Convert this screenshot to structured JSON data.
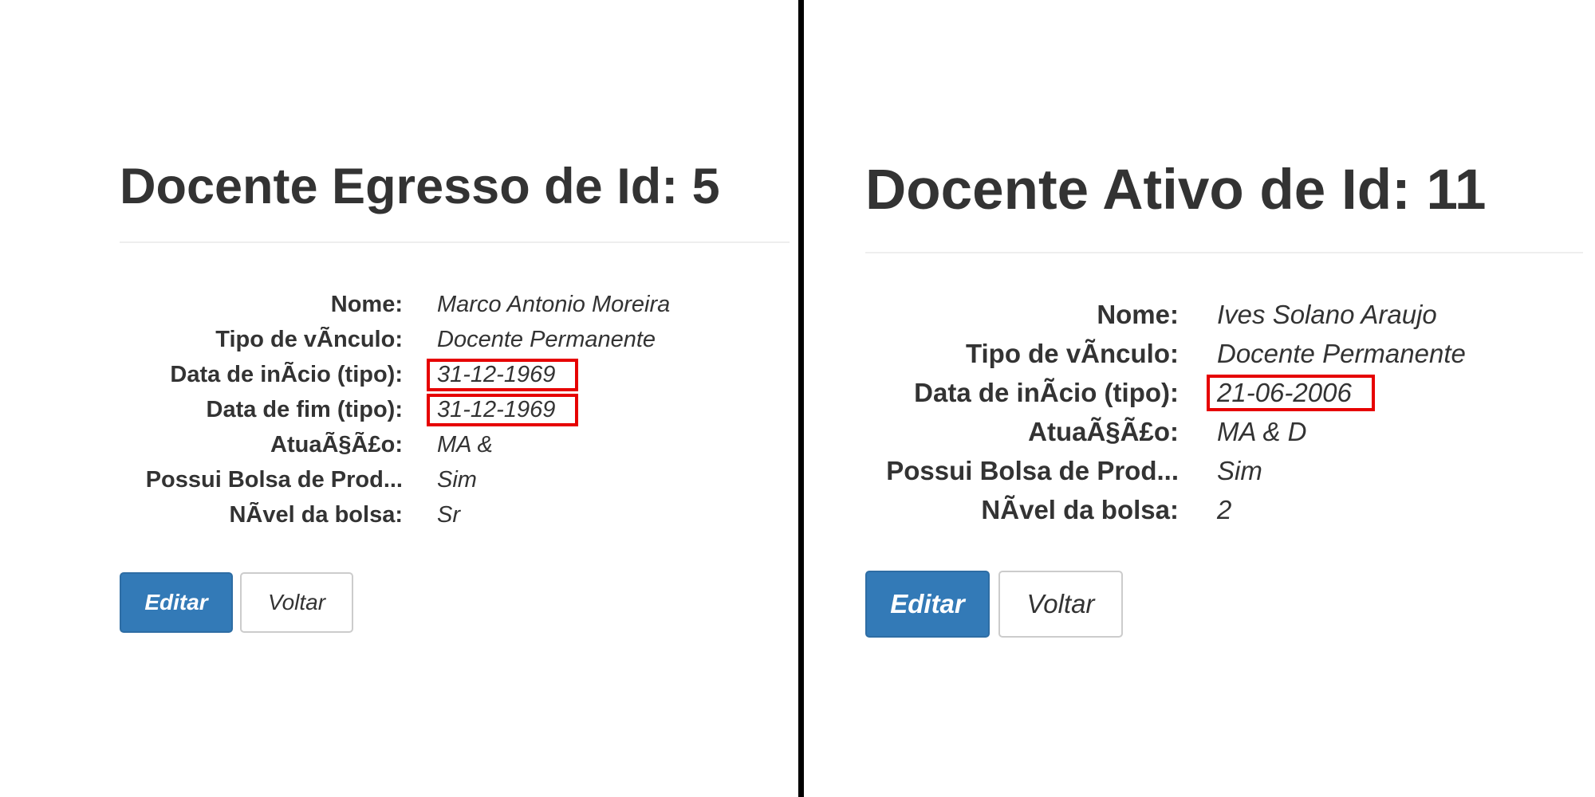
{
  "left": {
    "title": "Docente Egresso de Id: 5",
    "fields": [
      {
        "label": "Nome:",
        "value": "Marco Antonio Moreira"
      },
      {
        "label": "Tipo de vÃnculo:",
        "value": "Docente Permanente"
      },
      {
        "label": "Data de inÃcio (tipo):",
        "value": "31-12-1969"
      },
      {
        "label": "Data de fim (tipo):",
        "value": "31-12-1969"
      },
      {
        "label": "AtuaÃ§Ã£o:",
        "value": "MA &"
      },
      {
        "label": "Possui Bolsa de Prod...",
        "value": "Sim"
      },
      {
        "label": "NÃvel da bolsa:",
        "value": "Sr"
      }
    ],
    "edit_label": "Editar",
    "back_label": "Voltar"
  },
  "right": {
    "title": "Docente Ativo de Id: 11",
    "fields": [
      {
        "label": "Nome:",
        "value": "Ives Solano Araujo"
      },
      {
        "label": "Tipo de vÃnculo:",
        "value": "Docente Permanente"
      },
      {
        "label": "Data de inÃcio (tipo):",
        "value": "21-06-2006"
      },
      {
        "label": "AtuaÃ§Ã£o:",
        "value": "MA & D"
      },
      {
        "label": "Possui Bolsa de Prod...",
        "value": "Sim"
      },
      {
        "label": "NÃvel da bolsa:",
        "value": "2"
      }
    ],
    "edit_label": "Editar",
    "back_label": "Voltar"
  },
  "colors": {
    "highlight_border": "#e60000",
    "primary_button": "#337ab7",
    "divider": "#000000",
    "text": "#333333"
  }
}
